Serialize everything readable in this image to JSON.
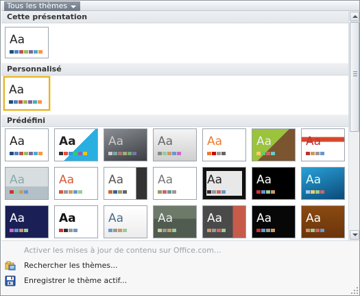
{
  "header": {
    "filter_label": "Tous les thèmes"
  },
  "sections": {
    "current": "Cette présentation",
    "custom": "Personnalisé",
    "builtin": "Prédéfini"
  },
  "thumbs": {
    "current": {
      "aa": "Aa"
    },
    "custom": {
      "aa": "Aa"
    },
    "builtin": [
      {
        "aa": "Aa"
      },
      {
        "aa": "Aa"
      },
      {
        "aa": "Aa"
      },
      {
        "aa": "Aa"
      },
      {
        "aa": "Aa"
      },
      {
        "aa": "Aa"
      },
      {
        "aa": "Aa"
      },
      {
        "aa": "Aa"
      },
      {
        "aa": "Aa"
      },
      {
        "aa": "Aa"
      },
      {
        "aa": "Aa"
      },
      {
        "aa": "Aa"
      },
      {
        "aa": "Aa"
      },
      {
        "aa": "Aa"
      },
      {
        "aa": "Aa"
      },
      {
        "aa": "Aa"
      },
      {
        "aa": "Aa"
      },
      {
        "aa": "Aa"
      },
      {
        "aa": "Aa"
      },
      {
        "aa": "Aa"
      },
      {
        "aa": "Aa"
      }
    ]
  },
  "menu": {
    "enable_updates": "Activer les mises à jour de contenu sur Office.com...",
    "browse_themes": "Rechercher les thèmes...",
    "save_theme": "Enregistrer le thème actif..."
  }
}
